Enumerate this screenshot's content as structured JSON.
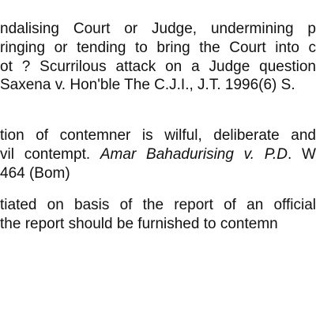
{
  "block1": {
    "line1": "ndalising Court or Judge, undermining p",
    "line2": "ringing or tending to bring the Court into c",
    "line3": "ot ? Scurrilous attack on a Judge question",
    "line4": "Saxena v. Hon'ble The C.J.I., J.T. 1996(6) S."
  },
  "block2": {
    "line1": "tion of contemner is wilful, deliberate and",
    "line2_start": "vil contempt. ",
    "line2_case": "Amar Bahadurising v. P.D",
    "line2_end": ". W",
    "line3": " 464 (Bom)"
  },
  "block3": {
    "line1": "tiated on basis of the report of an official",
    "line2": " the report should be furnished to contemn"
  }
}
